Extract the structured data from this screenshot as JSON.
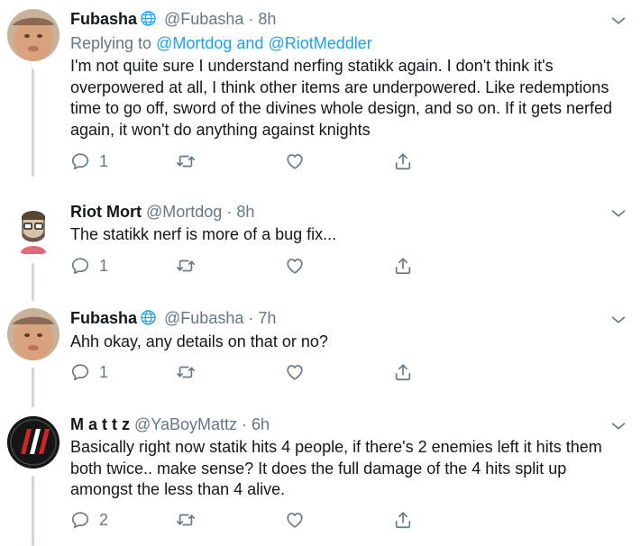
{
  "tweets": [
    {
      "name": "Fubasha",
      "verified_globe": true,
      "handle": "@Fubasha",
      "time": "· 8h",
      "reply_prefix": "Replying to",
      "reply_mention_1": "@Mortdog",
      "reply_and": "and",
      "reply_mention_2": "@RiotMeddler",
      "text": "I'm not quite sure I understand nerfing statikk again. I don't think it's overpowered at all, I think other items are underpowered. Like redemptions time to go off, sword of the divines whole design, and so on. If it gets nerfed again, it won't do anything against knights",
      "reply_count": "1",
      "avatar": "baby-photo"
    },
    {
      "name": "Riot Mort",
      "handle": "@Mortdog",
      "time": "· 8h",
      "text": "The statikk nerf is more of a bug fix...",
      "reply_count": "1",
      "avatar": "cartoon-avatar"
    },
    {
      "name": "Fubasha",
      "verified_globe": true,
      "handle": "@Fubasha",
      "time": "· 7h",
      "text": "Ahh okay, any details on that or no?",
      "reply_count": "1",
      "avatar": "baby-photo"
    },
    {
      "name": "M a t t z",
      "handle": "@YaBoyMattz",
      "time": "· 6h",
      "text": "Basically right now statik hits 4 people, if there's 2 enemies left it hits them both twice.. make sense? It does the full damage of the 4 hits split up amongst the less than 4 alive.",
      "reply_count": "2",
      "avatar": "red-logo"
    }
  ],
  "icons": {
    "reply": "reply-icon",
    "retweet": "retweet-icon",
    "like": "heart-icon",
    "share": "share-icon",
    "more": "chevron-down-icon",
    "globe": "globe-icon"
  },
  "colors": {
    "text": "#14171a",
    "secondary": "#657786",
    "link": "#1da1f2",
    "thread_line": "#ccd6dd"
  }
}
